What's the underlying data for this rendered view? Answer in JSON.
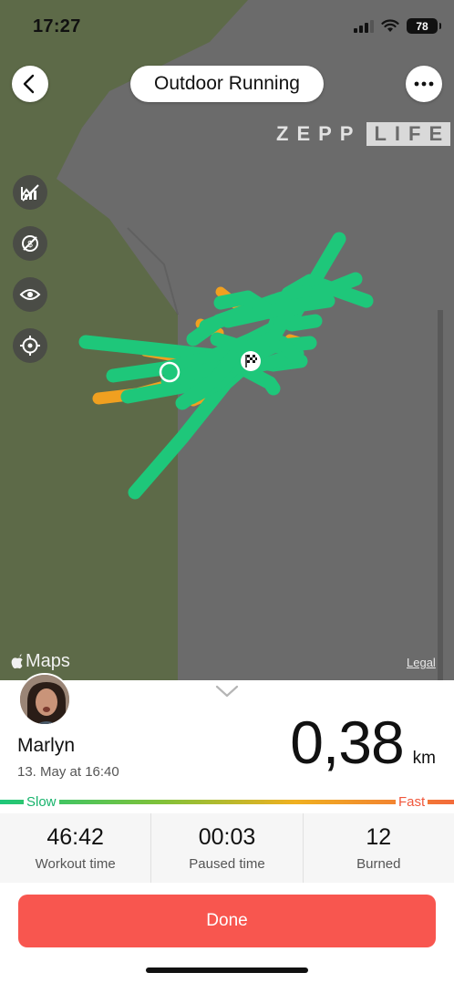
{
  "status_bar": {
    "time": "17:27",
    "battery": "78"
  },
  "header": {
    "title": "Outdoor Running"
  },
  "brand": {
    "part1": "ZEPP",
    "part2": "LIFE"
  },
  "map": {
    "maps_label": "Maps",
    "legal_label": "Legal"
  },
  "user": {
    "name": "Marlyn",
    "date": "13. May at 16:40"
  },
  "distance": {
    "value": "0,38",
    "unit": "km"
  },
  "pace_scale": {
    "slow_label": "Slow",
    "fast_label": "Fast"
  },
  "stats": [
    {
      "value": "46:42",
      "label": "Workout time"
    },
    {
      "value": "00:03",
      "label": "Paused time"
    },
    {
      "value": "12",
      "label": "Burned"
    }
  ],
  "done_button": {
    "label": "Done"
  },
  "colors": {
    "route_green": "#1ec77a",
    "route_orange": "#f0a020",
    "accent_red": "#f8564f",
    "map_green": "#5d6a48",
    "map_gray": "#6b6b6b"
  }
}
